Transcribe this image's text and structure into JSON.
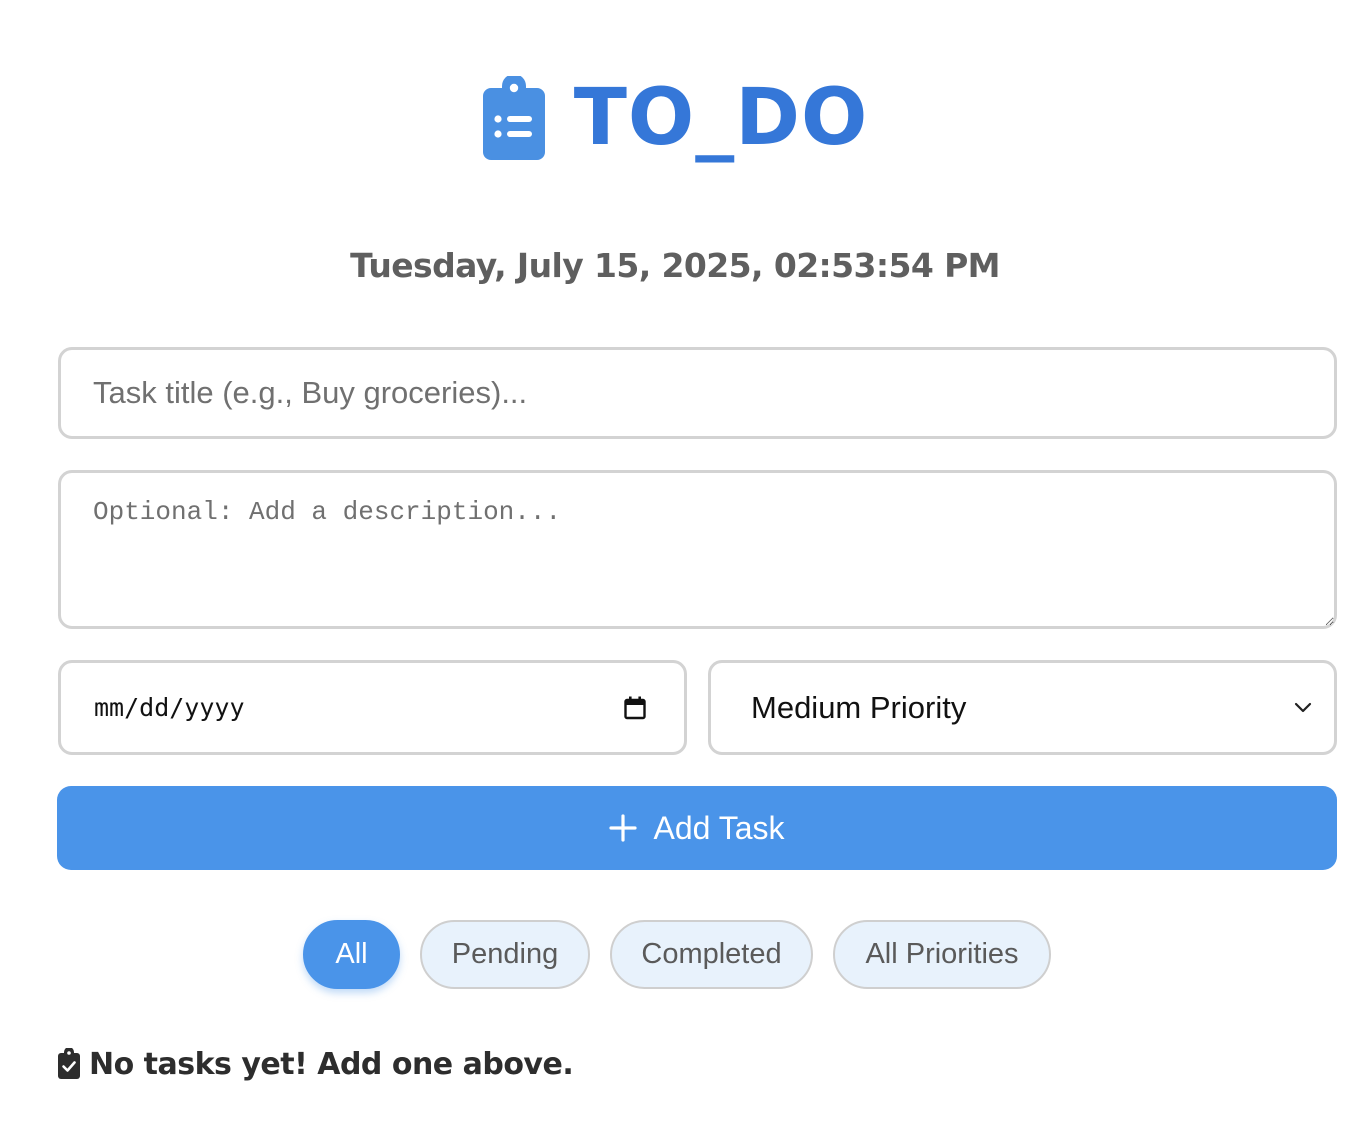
{
  "header": {
    "title": "TO_DO",
    "logo_icon": "clipboard-list-icon",
    "accent_color": "#3577d8"
  },
  "datetime": "Tuesday, July 15, 2025, 02:53:54 PM",
  "form": {
    "title_placeholder": "Task title (e.g., Buy groceries)...",
    "title_value": "",
    "description_placeholder": "Optional: Add a description...",
    "description_value": "",
    "date_placeholder": "mm/dd/yyyy",
    "date_icon": "calendar-icon",
    "priority_selected": "Medium Priority",
    "priority_icon": "chevron-down-icon",
    "add_button_label": "Add Task",
    "add_button_icon": "plus-icon",
    "button_color": "#4a94e9"
  },
  "filters": {
    "items": [
      {
        "label": "All",
        "active": true
      },
      {
        "label": "Pending",
        "active": false
      },
      {
        "label": "Completed",
        "active": false
      },
      {
        "label": "All Priorities",
        "active": false
      }
    ]
  },
  "empty_state": {
    "icon": "clipboard-check-icon",
    "message": "No tasks yet! Add one above."
  }
}
